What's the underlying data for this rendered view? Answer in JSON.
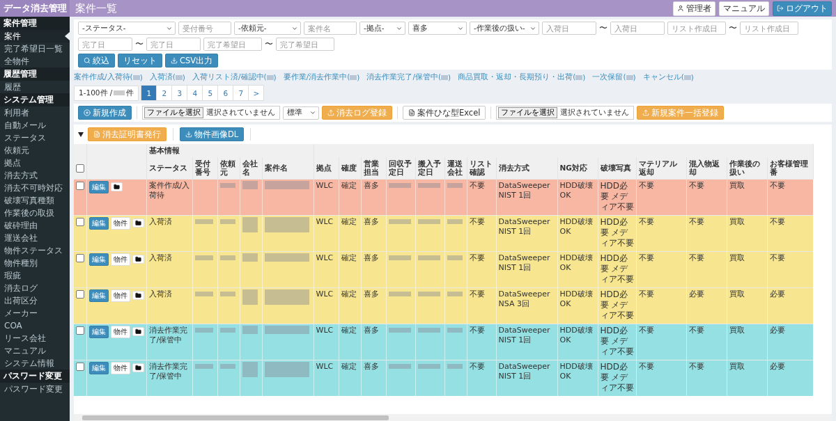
{
  "app_title": "データ消去管理",
  "page_title": "案件一覧",
  "header_buttons": [
    {
      "kind": "user",
      "label": "管理者"
    },
    {
      "kind": "plain",
      "label": "マニュアル"
    },
    {
      "kind": "logout",
      "label": "ログアウト"
    }
  ],
  "sidebar": [
    {
      "title": "案件管理",
      "items": [
        {
          "label": "案件",
          "selected": true
        },
        {
          "label": "完了希望日一覧",
          "selected": false
        },
        {
          "label": "全物件",
          "selected": false
        }
      ]
    },
    {
      "title": "履歴管理",
      "items": [
        {
          "label": "履歴",
          "selected": false
        }
      ]
    },
    {
      "title": "システム管理",
      "items": [
        {
          "label": "利用者",
          "selected": false
        },
        {
          "label": "自動メール",
          "selected": false
        },
        {
          "label": "ステータス",
          "selected": false
        },
        {
          "label": "依頼元",
          "selected": false
        },
        {
          "label": "拠点",
          "selected": false
        },
        {
          "label": "消去方式",
          "selected": false
        },
        {
          "label": "消去不可時対応",
          "selected": false
        },
        {
          "label": "破壊写真種類",
          "selected": false
        },
        {
          "label": "作業後の取扱",
          "selected": false
        },
        {
          "label": "破砕理由",
          "selected": false
        },
        {
          "label": "運送会社",
          "selected": false
        },
        {
          "label": "物件ステータス",
          "selected": false
        },
        {
          "label": "物件種別",
          "selected": false
        },
        {
          "label": "瑕疵",
          "selected": false
        },
        {
          "label": "消去ログ",
          "selected": false
        },
        {
          "label": "出荷区分",
          "selected": false
        },
        {
          "label": "メーカー",
          "selected": false
        },
        {
          "label": "COA",
          "selected": false
        },
        {
          "label": "リース会社",
          "selected": false
        },
        {
          "label": "マニュアル",
          "selected": false
        },
        {
          "label": "システム情報",
          "selected": false
        }
      ]
    },
    {
      "title": "パスワード変更",
      "items": [
        {
          "label": "パスワード変更",
          "selected": false
        }
      ]
    }
  ],
  "filters": [
    {
      "kind": "select",
      "value": "-ステータス-"
    },
    {
      "kind": "input",
      "placeholder": "受付番号"
    },
    {
      "kind": "select",
      "value": "-依頼元-"
    },
    {
      "kind": "input",
      "placeholder": "案件名"
    },
    {
      "kind": "select",
      "value": "-拠点-"
    },
    {
      "kind": "select",
      "value": "喜多"
    },
    {
      "kind": "select",
      "value": "-作業後の扱い-"
    },
    {
      "kind": "input",
      "placeholder": "入荷日"
    },
    {
      "kind": "tilde",
      "label": "〜"
    },
    {
      "kind": "input",
      "placeholder": "入荷日"
    },
    {
      "kind": "input",
      "placeholder": "リスト作成日"
    },
    {
      "kind": "tilde",
      "label": "〜"
    },
    {
      "kind": "input",
      "placeholder": "リスト作成日"
    },
    {
      "kind": "input",
      "placeholder": "完了日"
    },
    {
      "kind": "tilde",
      "label": "〜"
    },
    {
      "kind": "input",
      "placeholder": "完了日"
    },
    {
      "kind": "input",
      "placeholder": "完了希望日"
    },
    {
      "kind": "tilde",
      "label": "〜"
    },
    {
      "kind": "input",
      "placeholder": "完了希望日"
    }
  ],
  "filter_buttons": [
    {
      "kind": "search",
      "label": "絞込"
    },
    {
      "kind": "plain",
      "label": "リセット"
    },
    {
      "kind": "download",
      "label": "CSV出力"
    }
  ],
  "status_links": [
    {
      "before": "案件作成/入荷待(",
      "after": ")"
    },
    {
      "before": "入荷済(",
      "after": ")"
    },
    {
      "before": "入荷リスト済/確認中(",
      "after": ")"
    },
    {
      "before": "要作業/消去作業中(",
      "after": ")"
    },
    {
      "before": "消去作業完了/保管中(",
      "after": ")"
    },
    {
      "before": "商品買取・返却・長期預り・出荷(",
      "after": ")"
    },
    {
      "before": "一次保留(",
      "after": ")"
    },
    {
      "before": "キャンセル(",
      "after": ")"
    }
  ],
  "pagination": {
    "summary_before": "1-100件 /",
    "summary_after": "件",
    "pages": [
      {
        "label": "1",
        "selected": true
      },
      {
        "label": "2",
        "selected": false
      },
      {
        "label": "3",
        "selected": false
      },
      {
        "label": "4",
        "selected": false
      },
      {
        "label": "5",
        "selected": false
      },
      {
        "label": "6",
        "selected": false
      },
      {
        "label": "7",
        "selected": false
      },
      {
        "label": ">",
        "selected": false
      }
    ]
  },
  "toolbar": [
    {
      "kind": "primary",
      "label": "新規作成"
    },
    {
      "kind": "file",
      "button": "ファイルを選択",
      "status": "選択されていません"
    },
    {
      "kind": "select",
      "value": "標準"
    },
    {
      "kind": "warning",
      "label": "消去ログ登録"
    },
    {
      "kind": "outline",
      "label": "案件ひな型Excel"
    },
    {
      "kind": "file",
      "button": "ファイルを選択",
      "status": "選択されていません"
    },
    {
      "kind": "warning",
      "label": "新規案件一括登録"
    }
  ],
  "table_actions": [
    {
      "kind": "warning",
      "label": "消去証明書発行"
    },
    {
      "kind": "primary",
      "label": "物件画像DL"
    }
  ],
  "table": {
    "group_header": "基本情報",
    "select_all_checked": false,
    "columns": [
      "ステータス",
      "受付番号",
      "依頼元",
      "会社名",
      "案件名",
      "拠点",
      "確度",
      "営業担当",
      "回収予定日",
      "搬入予定日",
      "運送会社",
      "リスト確認",
      "消去方式",
      "NG対応",
      "破壊写真",
      "マテリアル返却",
      "混入物返却",
      "作業後の扱い",
      "お客様管理番"
    ],
    "rows": [
      {
        "color": "#f7b7a3",
        "checked": false,
        "edit": "編集",
        "item": null,
        "status": "案件作成/入荷待",
        "branch": "WLC",
        "certainty": "確定",
        "sales": "喜多",
        "list_check": "不要",
        "method": "DataSweeper NIST 1回",
        "ng": "HDD破壊OK",
        "photo": "HDD必要 メディア不要",
        "material": "不要",
        "mixed": "不要",
        "after": "買取",
        "customer_no": "不要"
      },
      {
        "color": "#f7e58f",
        "checked": false,
        "edit": "編集",
        "item": "物件",
        "status": "入荷済",
        "branch": "WLC",
        "certainty": "確定",
        "sales": "喜多",
        "list_check": "不要",
        "method": "DataSweeper NIST 1回",
        "ng": "HDD破壊OK",
        "photo": "HDD必要 メディア不要",
        "material": "不要",
        "mixed": "不要",
        "after": "買取",
        "customer_no": "不要"
      },
      {
        "color": "#f7e58f",
        "checked": false,
        "edit": "編集",
        "item": "物件",
        "status": "入荷済",
        "branch": "WLC",
        "certainty": "確定",
        "sales": "喜多",
        "list_check": "不要",
        "method": "DataSweeper NIST 1回",
        "ng": "HDD破壊OK",
        "photo": "HDD必要 メディア不要",
        "material": "不要",
        "mixed": "不要",
        "after": "買取",
        "customer_no": "不要"
      },
      {
        "color": "#f7e58f",
        "checked": false,
        "edit": "編集",
        "item": "物件",
        "status": "入荷済",
        "branch": "WLC",
        "certainty": "確定",
        "sales": "喜多",
        "list_check": "不要",
        "method": "DataSweeper NSA 3回",
        "ng": "HDD破壊OK",
        "photo": "HDD必要 メディア不要",
        "material": "不要",
        "mixed": "必要",
        "after": "買取",
        "customer_no": "必要"
      },
      {
        "color": "#94e0e3",
        "checked": false,
        "edit": "編集",
        "item": "物件",
        "status": "消去作業完了/保管中",
        "branch": "WLC",
        "certainty": "確定",
        "sales": "喜多",
        "list_check": "不要",
        "method": "DataSweeper NIST 1回",
        "ng": "HDD破壊OK",
        "photo": "HDD必要 メディア不要",
        "material": "不要",
        "mixed": "不要",
        "after": "買取",
        "customer_no": "必要"
      },
      {
        "color": "#94e0e3",
        "checked": false,
        "edit": "編集",
        "item": "物件",
        "status": "消去作業完了/保管中",
        "branch": "WLC",
        "certainty": "確定",
        "sales": "喜多",
        "list_check": "不要",
        "method": "DataSweeper NIST 1回",
        "ng": "HDD破壊OK",
        "photo": "HDD必要 メディア不要",
        "material": "不要",
        "mixed": "不要",
        "after": "買取",
        "customer_no": "必要"
      }
    ]
  }
}
